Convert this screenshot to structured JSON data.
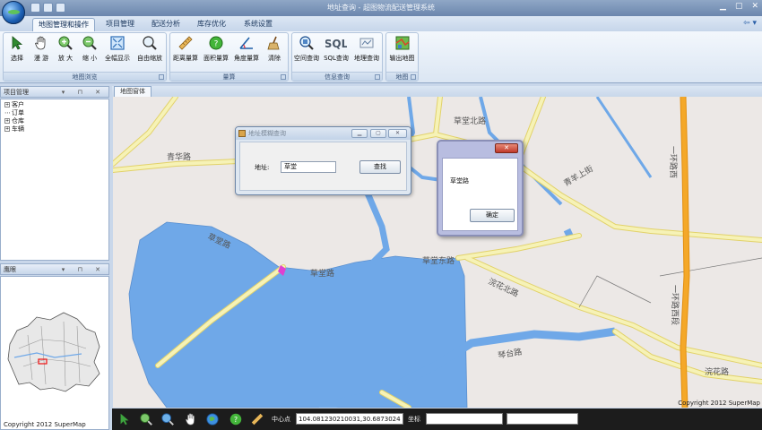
{
  "window": {
    "title": "地址查询 - 超图物流配送管理系统"
  },
  "ribbon_tabs": [
    "地图管理和操作",
    "项目管理",
    "配送分析",
    "库存优化",
    "系统设置"
  ],
  "ribbon_groups": {
    "map_browse": {
      "label": "地图浏览",
      "buttons": [
        "选择",
        "漫 游",
        "放 大",
        "缩 小",
        "全幅显示",
        "自由缩放"
      ]
    },
    "measure": {
      "label": "量算",
      "buttons": [
        "距离量算",
        "面积量算",
        "角度量算",
        "清除"
      ]
    },
    "info_query": {
      "label": "信息查询",
      "buttons": [
        "空间查询",
        "SQL查询",
        "地理查询"
      ]
    },
    "output": {
      "label": "地图",
      "buttons": [
        "输出地图"
      ]
    }
  },
  "project_panel": {
    "title": "项目管理",
    "tree": [
      "客户",
      "订单",
      "仓库",
      "车辆"
    ]
  },
  "overview_panel": {
    "title": "鹰眼",
    "copyright": "Copyright 2012 SuperMap"
  },
  "document_tab": "地图窗体",
  "map": {
    "road_labels": [
      "青华路",
      "青羊上街",
      "草堂路",
      "草堂路",
      "草堂东路",
      "浣花北路",
      "一环路西",
      "琴台路",
      "草堂北路",
      "浣花路",
      "一环路西段"
    ],
    "copyright": "Copyright 2012 SuperMap"
  },
  "address_dialog": {
    "title": "地址模糊查询",
    "address_label": "地址:",
    "address_value": "草堂",
    "search_button": "查找"
  },
  "message_box": {
    "close_label": "✕",
    "message": "草堂路",
    "ok_button": "确定"
  },
  "status_bar": {
    "center_label": "中心点",
    "center_value": "104.081230210031,30.6873024",
    "coord_label": "坐标",
    "coord_value": "",
    "extra_value": ""
  },
  "colors": {
    "water": "#6fa8e8",
    "land": "#ece8e6",
    "road": "#f6f2b6",
    "road_outline": "#e2d26a",
    "highway": "#f4a829"
  }
}
